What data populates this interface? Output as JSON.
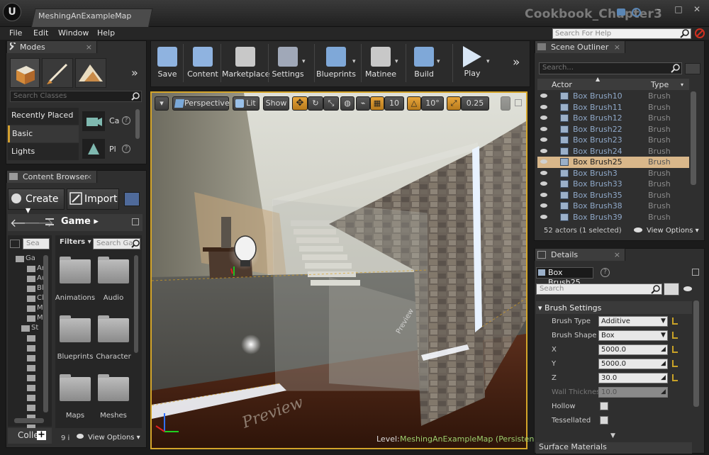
{
  "app": {
    "logo_text": "U",
    "doc_tab": "MeshingAnExampleMap",
    "project_name": "Cookbook_Chapter3"
  },
  "window": {
    "minimize": "–",
    "maximize": "□",
    "close": "✕"
  },
  "menubar": {
    "items": [
      "File",
      "Edit",
      "Window",
      "Help"
    ],
    "help_search_placeholder": "Search For Help"
  },
  "modes": {
    "tab_label": "Modes",
    "more": "»",
    "search_placeholder": "Search Classes",
    "categories": [
      "Recently Placed",
      "Basic",
      "Lights"
    ],
    "items": [
      "Ca",
      "Pl"
    ]
  },
  "content_browser": {
    "tab_label": "Content Browser",
    "create_label": "Create",
    "import_label": "Import",
    "path_label": "Game",
    "search_paths_placeholder": "Sea",
    "search_assets_placeholder": "Search Ga",
    "filters_label": "Filters",
    "tree": [
      "Ga",
      "Ar",
      "Au",
      "Bl",
      "Cl",
      "M",
      "M",
      "St",
      "",
      "",
      "",
      "",
      "",
      "",
      "",
      "",
      "",
      ""
    ],
    "folders": [
      "Animations",
      "Audio",
      "Blueprints",
      "Character",
      "Maps",
      "Meshes"
    ],
    "collections_label": "Colle",
    "count_label": "9 i",
    "view_options": "View Options"
  },
  "toolbar": {
    "buttons": [
      "Save",
      "Content",
      "Marketplace",
      "Settings",
      "Blueprints",
      "Matinee",
      "Build",
      "Play"
    ],
    "more": "»"
  },
  "viewport": {
    "perspective": "Perspective",
    "lit": "Lit",
    "show": "Show",
    "grid_snap": "10",
    "rot_snap": "10°",
    "scale_snap": "0.25",
    "level_label": "Level:",
    "level_name": "MeshingAnExampleMap (Persistent)",
    "overlay_text_1": "Preview",
    "overlay_text_2": "Preview"
  },
  "outliner": {
    "tab_label": "Scene Outliner",
    "search_placeholder": "Search...",
    "col_actor": "Actor",
    "col_type": "Type",
    "rows": [
      {
        "name": "Box Brush10",
        "type": "Brush"
      },
      {
        "name": "Box Brush11",
        "type": "Brush"
      },
      {
        "name": "Box Brush12",
        "type": "Brush"
      },
      {
        "name": "Box Brush22",
        "type": "Brush"
      },
      {
        "name": "Box Brush23",
        "type": "Brush"
      },
      {
        "name": "Box Brush24",
        "type": "Brush"
      },
      {
        "name": "Box Brush25",
        "type": "Brush",
        "selected": true
      },
      {
        "name": "Box Brush3",
        "type": "Brush"
      },
      {
        "name": "Box Brush33",
        "type": "Brush"
      },
      {
        "name": "Box Brush35",
        "type": "Brush"
      },
      {
        "name": "Box Brush38",
        "type": "Brush"
      },
      {
        "name": "Box Brush39",
        "type": "Brush"
      }
    ],
    "status": "52 actors (1 selected)",
    "view_options": "View Options"
  },
  "details": {
    "tab_label": "Details",
    "selected_name": "Box Brush25",
    "search_placeholder": "Search",
    "section": "Brush Settings",
    "rows": [
      {
        "label": "Brush Type",
        "value": "Additive",
        "kind": "dropdown"
      },
      {
        "label": "Brush Shape",
        "value": "Box",
        "kind": "dropdown"
      },
      {
        "label": "X",
        "value": "5000.0",
        "kind": "number"
      },
      {
        "label": "Y",
        "value": "5000.0",
        "kind": "number"
      },
      {
        "label": "Z",
        "value": "30.0",
        "kind": "number"
      },
      {
        "label": "Wall Thicknes",
        "value": "10.0",
        "kind": "disabled"
      },
      {
        "label": "Hollow",
        "kind": "checkbox"
      },
      {
        "label": "Tessellated",
        "kind": "checkbox"
      }
    ],
    "next_section": "Surface Materials"
  },
  "colors": {
    "accent": "#c9a227",
    "selection": "#d9b78a",
    "viewport_border": "#d4a52a"
  }
}
